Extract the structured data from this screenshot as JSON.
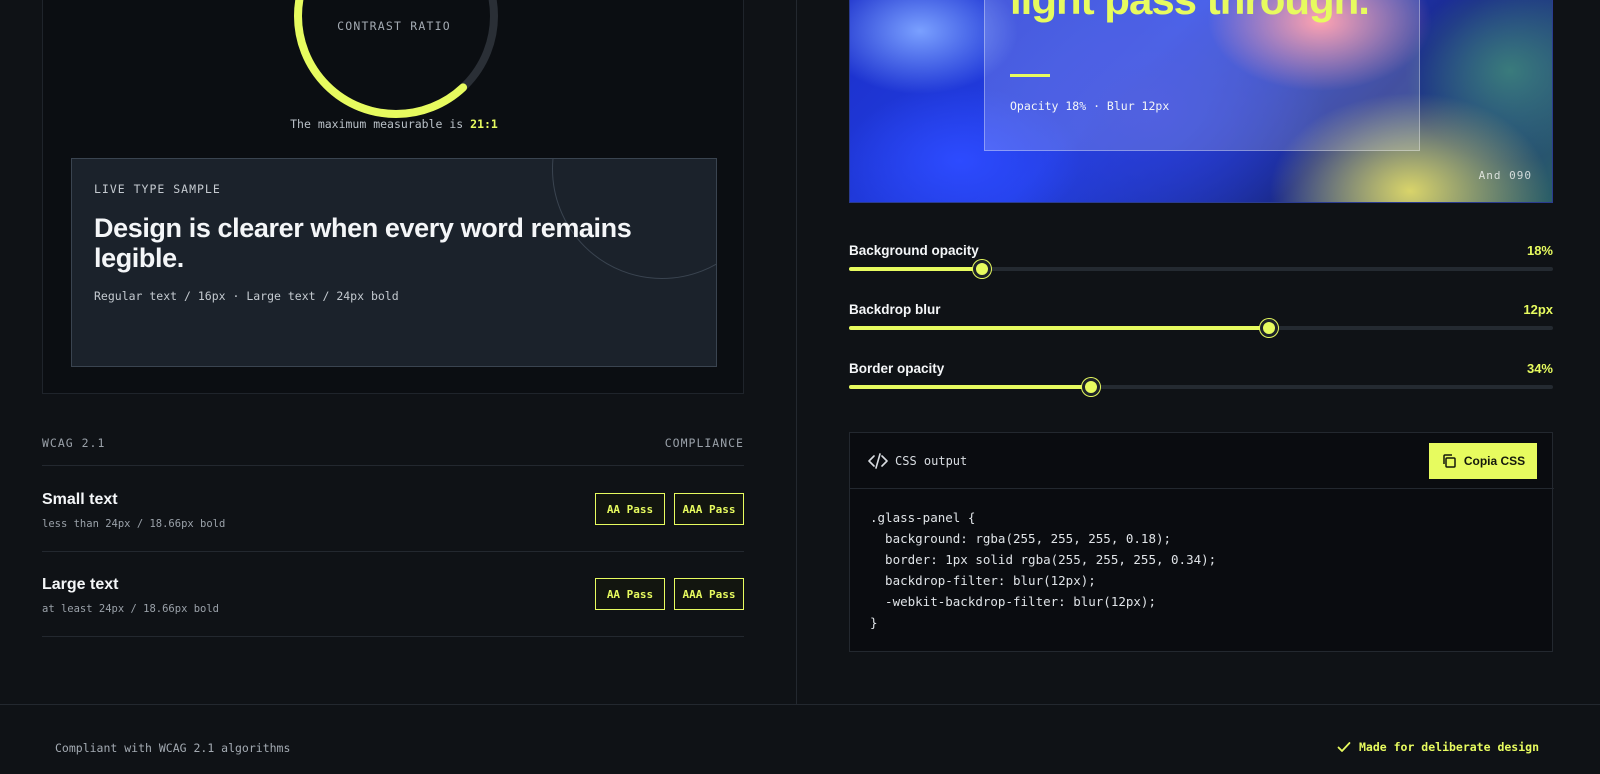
{
  "contrast": {
    "ring_label": "CONTRAST RATIO",
    "max_prefix": "The maximum measurable is",
    "max_value": "21:1"
  },
  "type_sample": {
    "label": "LIVE TYPE SAMPLE",
    "headline": "Design is clearer when every word remains legible.",
    "meta": "Regular text / 16px · Large text / 24px bold"
  },
  "wcag": {
    "header_left": "WCAG 2.1",
    "header_right": "COMPLIANCE",
    "rows": [
      {
        "title": "Small text",
        "sub": "less than 24px / 18.66px bold",
        "aa": "AA Pass",
        "aaa": "AAA Pass"
      },
      {
        "title": "Large text",
        "sub": "at least 24px / 18.66px bold",
        "aa": "AA Pass",
        "aaa": "AAA Pass"
      }
    ]
  },
  "glass": {
    "headline": "light pass through.",
    "spec": "Opacity 18%  ·  Blur 12px",
    "credit": "And 090"
  },
  "sliders": [
    {
      "label": "Background opacity",
      "value_text": "18%",
      "fraction": 0.189
    },
    {
      "label": "Backdrop blur",
      "value_text": "12px",
      "fraction": 0.597
    },
    {
      "label": "Border opacity",
      "value_text": "34%",
      "fraction": 0.344
    }
  ],
  "css_output": {
    "title": "CSS output",
    "copy_label": "Copia CSS",
    "code": ".glass-panel {\n  background: rgba(255, 255, 255, 0.18);\n  border: 1px solid rgba(255, 255, 255, 0.34);\n  backdrop-filter: blur(12px);\n  -webkit-backdrop-filter: blur(12px);\n}"
  },
  "footer": {
    "left": "Compliant with WCAG 2.1 algorithms",
    "right": "Made for deliberate design"
  },
  "colors": {
    "accent": "#e7fb5f",
    "background": "#0f1216"
  }
}
